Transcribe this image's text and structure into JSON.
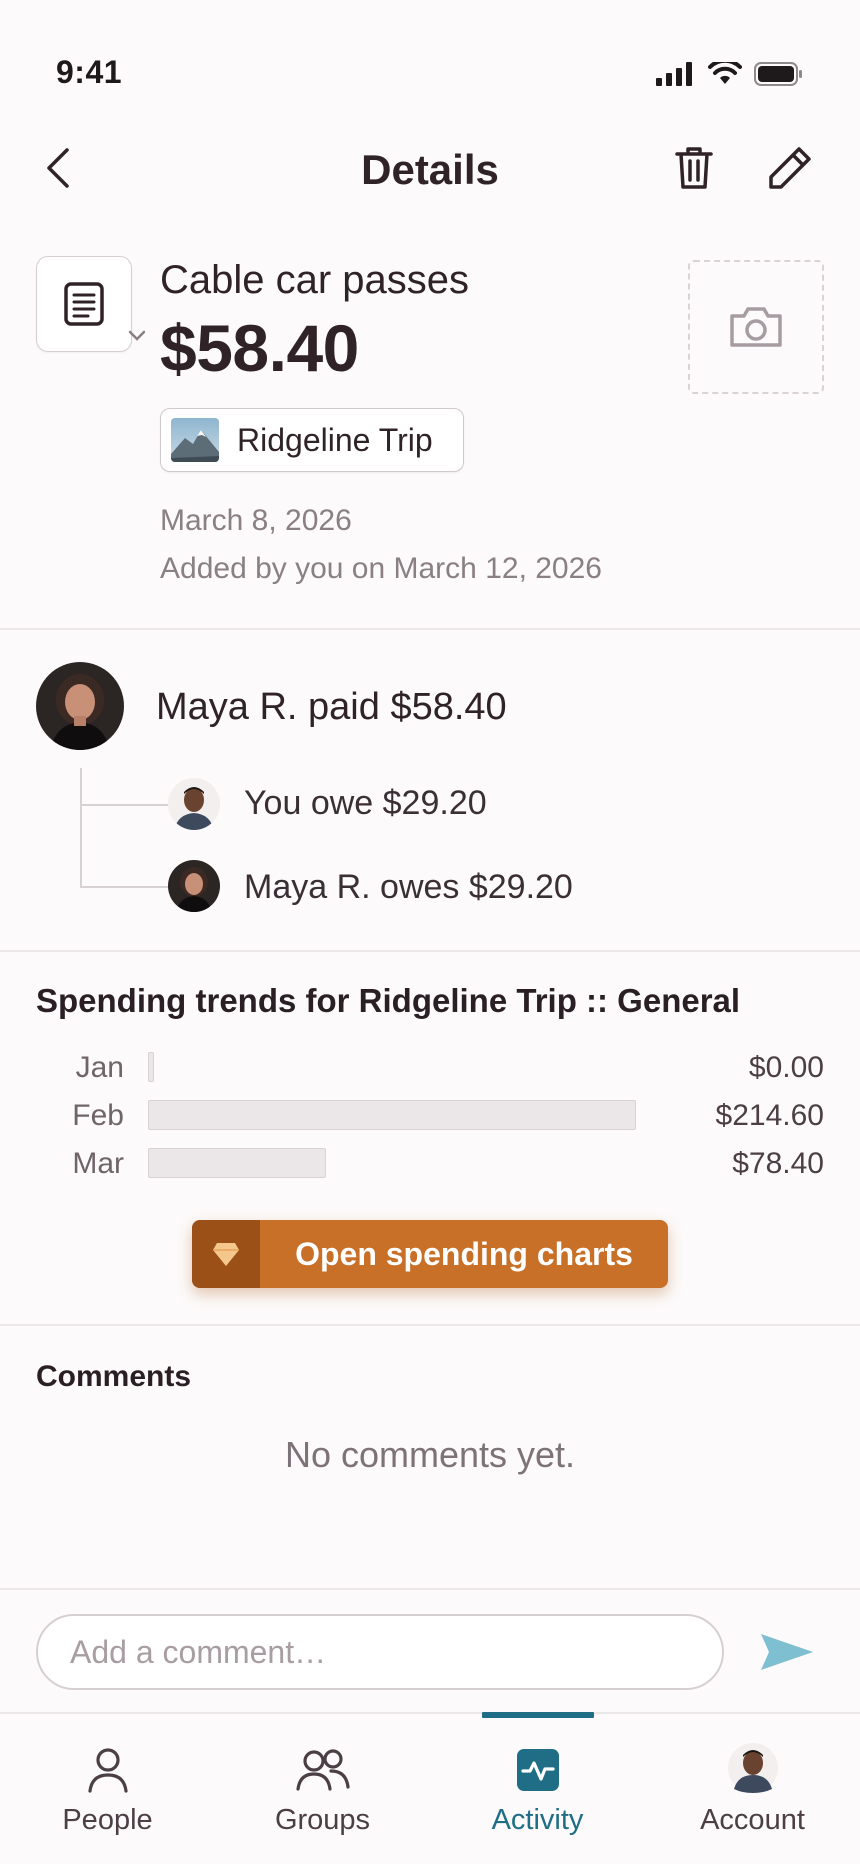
{
  "status_bar": {
    "time": "9:41"
  },
  "header": {
    "title": "Details"
  },
  "expense": {
    "title": "Cable car passes",
    "amount": "$58.40",
    "group": "Ridgeline Trip",
    "date": "March 8, 2026",
    "added_by": "Added by you on March 12, 2026"
  },
  "payment": {
    "payer_text": "Maya R. paid $58.40",
    "shares": [
      {
        "text": "You owe $29.20"
      },
      {
        "text": "Maya R. owes $29.20"
      }
    ]
  },
  "trends": {
    "title": "Spending trends for Ridgeline Trip :: General",
    "button_label": "Open spending charts",
    "max_value": 214.6,
    "rows": [
      {
        "month": "Jan",
        "amount": 0.0,
        "label": "$0.00"
      },
      {
        "month": "Feb",
        "amount": 214.6,
        "label": "$214.60"
      },
      {
        "month": "Mar",
        "amount": 78.4,
        "label": "$78.40"
      }
    ]
  },
  "comments": {
    "title": "Comments",
    "empty_text": "No comments yet.",
    "input_placeholder": "Add a comment…",
    "input_value": ""
  },
  "tabbar": {
    "tabs": [
      {
        "label": "People"
      },
      {
        "label": "Groups"
      },
      {
        "label": "Activity",
        "active": true
      },
      {
        "label": "Account"
      }
    ]
  },
  "colors": {
    "accent": "#1f6e86",
    "button_orange": "#c86f28",
    "send_arrow": "#7fbfd2"
  }
}
